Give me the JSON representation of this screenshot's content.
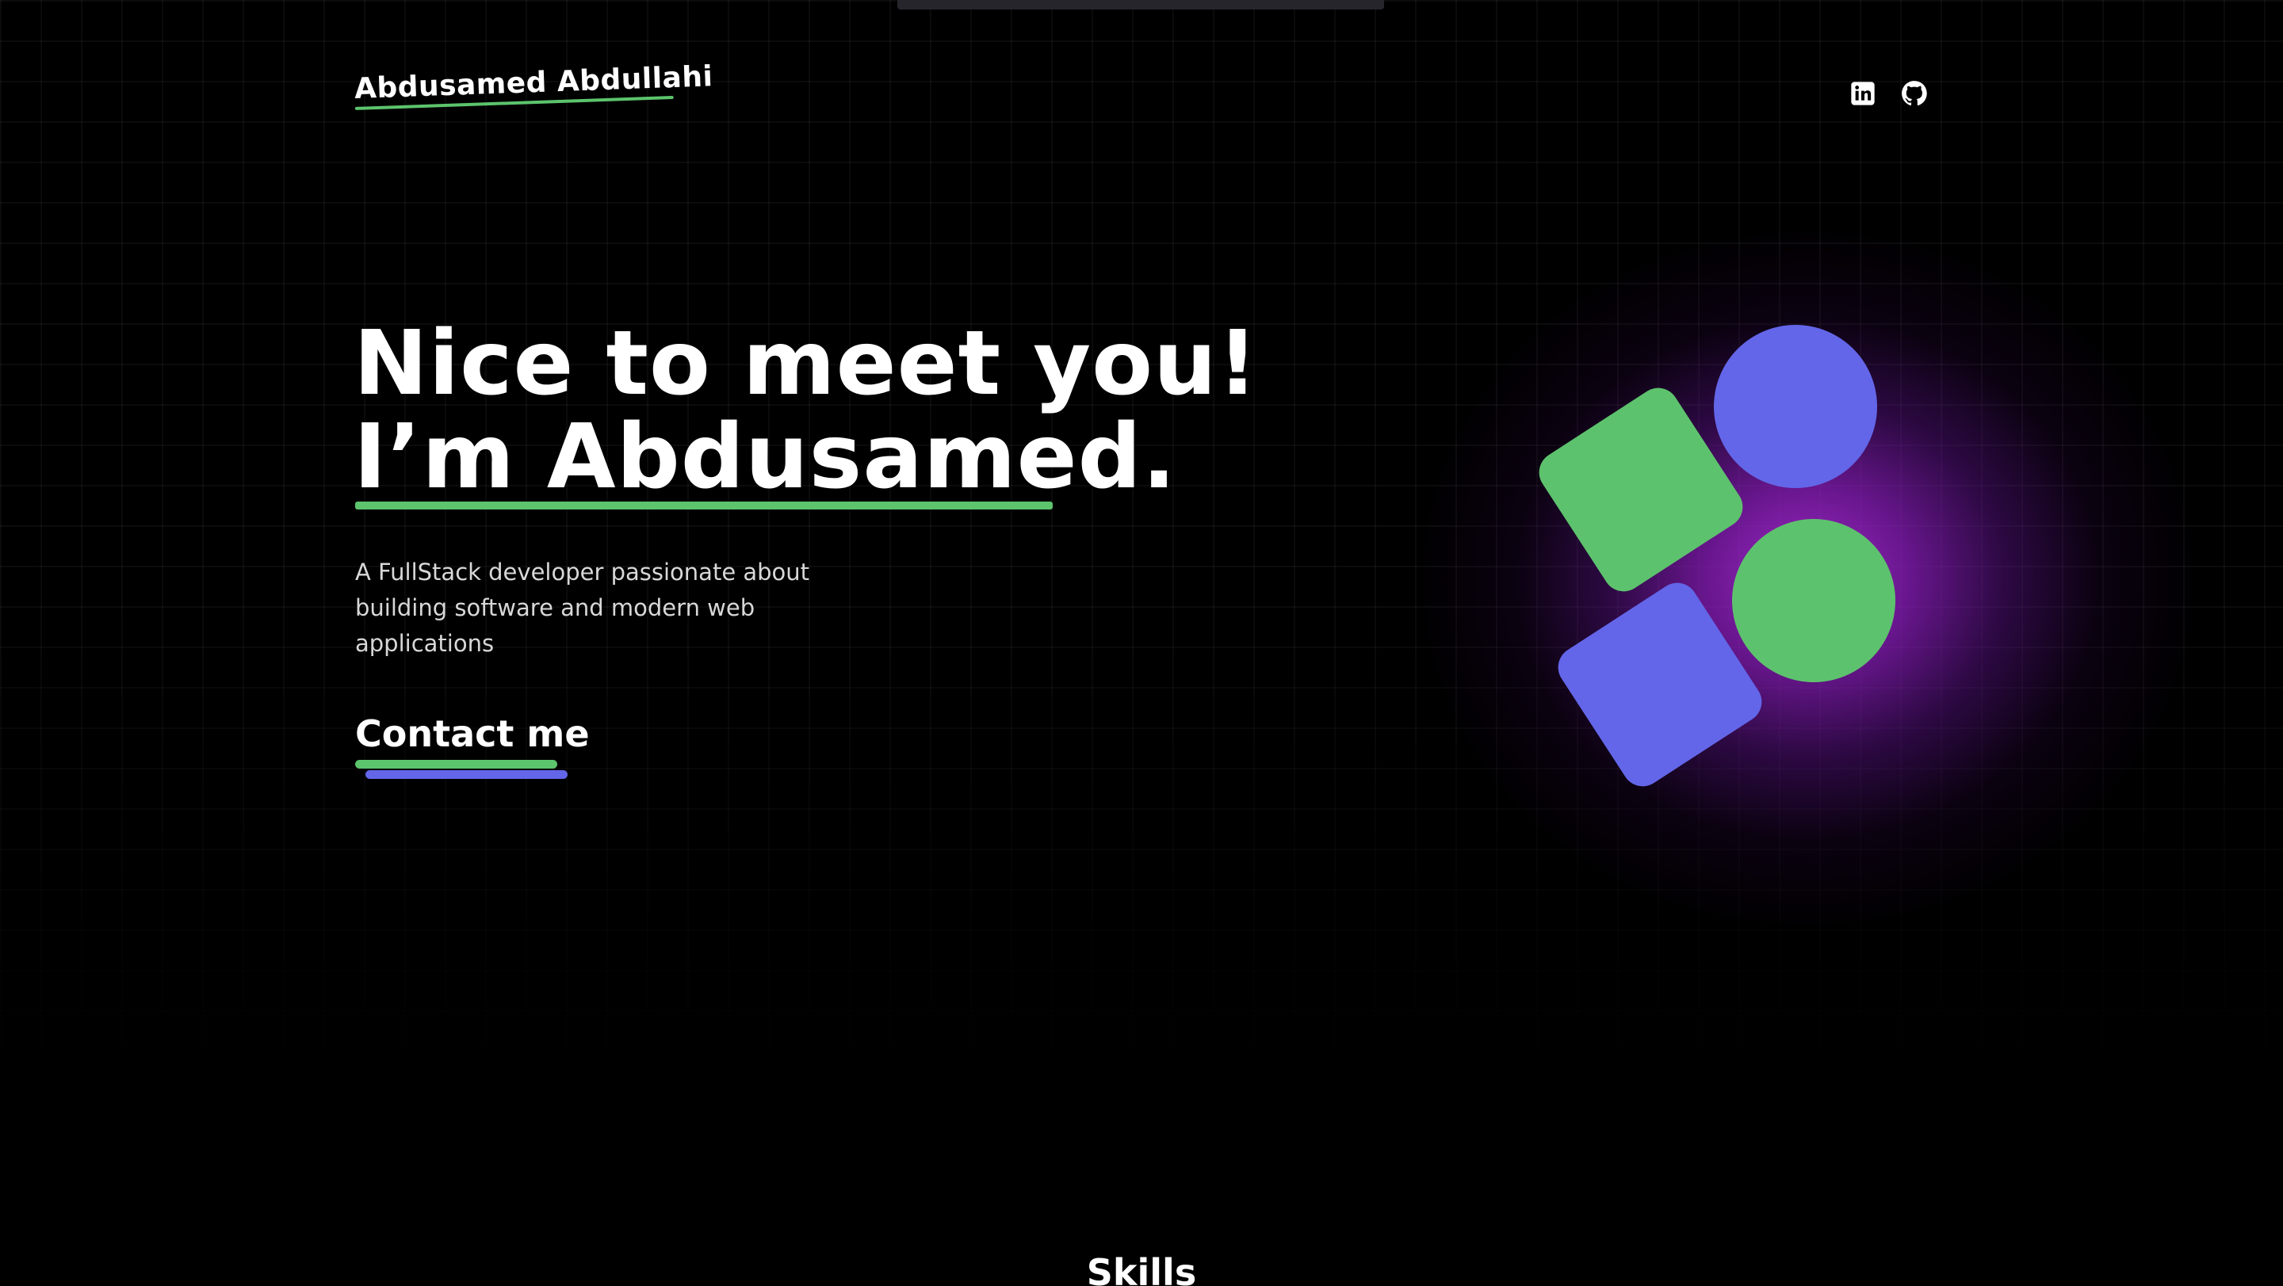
{
  "header": {
    "brand_name": "Abdusamed Abdullahi",
    "social": [
      {
        "icon": "linkedin-icon",
        "label": "LinkedIn"
      },
      {
        "icon": "github-icon",
        "label": "GitHub"
      }
    ]
  },
  "hero": {
    "title_line_1": "Nice to meet you!",
    "title_line_2": "I’m Abdusamed.",
    "description": "A FullStack developer passionate about building software and modern web applications",
    "cta_label": "Contact me"
  },
  "sections": {
    "skills_title": "Skills"
  },
  "colors": {
    "background": "#000000",
    "accent_green": "#5dc26d",
    "accent_blue": "#6366e8",
    "glow_purple": "#a82cd2"
  }
}
